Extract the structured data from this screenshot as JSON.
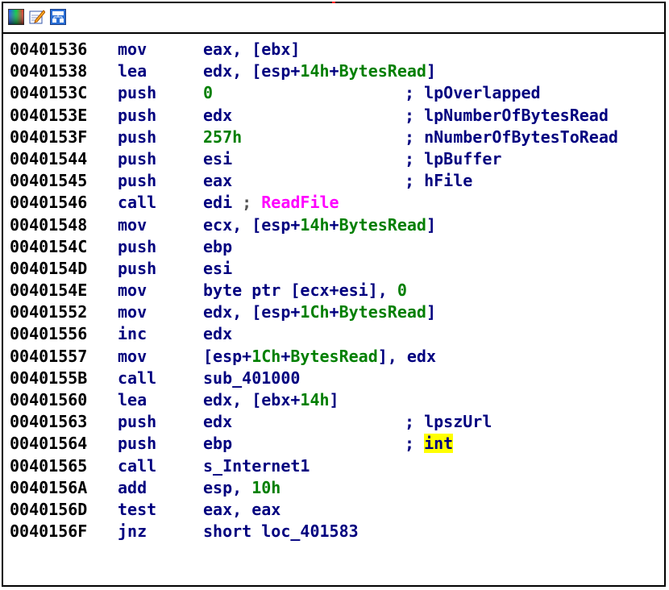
{
  "window": {
    "toolbar": [
      {
        "name": "graph-overview-icon"
      },
      {
        "name": "edit-icon"
      },
      {
        "name": "flowchart-icon"
      }
    ],
    "accent_colors": {
      "address": "#000000",
      "code": "#00007f",
      "number": "#007f00",
      "api_name": "#ff00ff",
      "highlight": "#ffff00",
      "marker": "#ff0000"
    }
  },
  "lines": [
    {
      "addr": "00401536",
      "mnemonic": "mov",
      "op": [
        [
          "plain",
          "eax, [ebx]"
        ]
      ],
      "comment": []
    },
    {
      "addr": "00401538",
      "mnemonic": "lea",
      "op": [
        [
          "plain",
          "edx, [esp+"
        ],
        [
          "num",
          "14h"
        ],
        [
          "plain",
          "+"
        ],
        [
          "var",
          "BytesRead"
        ],
        [
          "plain",
          "]"
        ]
      ],
      "comment": []
    },
    {
      "addr": "0040153C",
      "mnemonic": "push",
      "op": [
        [
          "num",
          "0"
        ]
      ],
      "comment": [
        [
          "plain",
          "; lpOverlapped"
        ]
      ]
    },
    {
      "addr": "0040153E",
      "mnemonic": "push",
      "op": [
        [
          "plain",
          "edx"
        ]
      ],
      "comment": [
        [
          "plain",
          "; lpNumberOfBytesRead"
        ]
      ]
    },
    {
      "addr": "0040153F",
      "mnemonic": "push",
      "op": [
        [
          "num",
          "257h"
        ]
      ],
      "comment": [
        [
          "plain",
          "; nNumberOfBytesToRead"
        ]
      ]
    },
    {
      "addr": "00401544",
      "mnemonic": "push",
      "op": [
        [
          "plain",
          "esi"
        ]
      ],
      "comment": [
        [
          "plain",
          "; lpBuffer"
        ]
      ]
    },
    {
      "addr": "00401545",
      "mnemonic": "push",
      "op": [
        [
          "plain",
          "eax"
        ]
      ],
      "comment": [
        [
          "plain",
          "; hFile"
        ]
      ]
    },
    {
      "addr": "00401546",
      "mnemonic": "call",
      "op": [
        [
          "plain",
          "edi "
        ],
        [
          "sep",
          "; "
        ],
        [
          "api",
          "ReadFile"
        ]
      ],
      "comment": []
    },
    {
      "addr": "00401548",
      "mnemonic": "mov",
      "op": [
        [
          "plain",
          "ecx, [esp+"
        ],
        [
          "num",
          "14h"
        ],
        [
          "plain",
          "+"
        ],
        [
          "var",
          "BytesRead"
        ],
        [
          "plain",
          "]"
        ]
      ],
      "comment": []
    },
    {
      "addr": "0040154C",
      "mnemonic": "push",
      "op": [
        [
          "plain",
          "ebp"
        ]
      ],
      "comment": []
    },
    {
      "addr": "0040154D",
      "mnemonic": "push",
      "op": [
        [
          "plain",
          "esi"
        ]
      ],
      "comment": []
    },
    {
      "addr": "0040154E",
      "mnemonic": "mov",
      "op": [
        [
          "plain",
          "byte ptr [ecx+esi], "
        ],
        [
          "num",
          "0"
        ]
      ],
      "comment": []
    },
    {
      "addr": "00401552",
      "mnemonic": "mov",
      "op": [
        [
          "plain",
          "edx, [esp+"
        ],
        [
          "num",
          "1Ch"
        ],
        [
          "plain",
          "+"
        ],
        [
          "var",
          "BytesRead"
        ],
        [
          "plain",
          "]"
        ]
      ],
      "comment": []
    },
    {
      "addr": "00401556",
      "mnemonic": "inc",
      "op": [
        [
          "plain",
          "edx"
        ]
      ],
      "comment": []
    },
    {
      "addr": "00401557",
      "mnemonic": "mov",
      "op": [
        [
          "plain",
          "[esp+"
        ],
        [
          "num",
          "1Ch"
        ],
        [
          "plain",
          "+"
        ],
        [
          "var",
          "BytesRead"
        ],
        [
          "plain",
          "], edx"
        ]
      ],
      "comment": []
    },
    {
      "addr": "0040155B",
      "mnemonic": "call",
      "op": [
        [
          "plain",
          "sub_401000"
        ]
      ],
      "comment": []
    },
    {
      "addr": "00401560",
      "mnemonic": "lea",
      "op": [
        [
          "plain",
          "edx, [ebx+"
        ],
        [
          "num",
          "14h"
        ],
        [
          "plain",
          "]"
        ]
      ],
      "comment": []
    },
    {
      "addr": "00401563",
      "mnemonic": "push",
      "op": [
        [
          "plain",
          "edx"
        ]
      ],
      "comment": [
        [
          "plain",
          "; lpszUrl"
        ]
      ]
    },
    {
      "addr": "00401564",
      "mnemonic": "push",
      "op": [
        [
          "plain",
          "ebp"
        ]
      ],
      "comment": [
        [
          "plain",
          "; "
        ],
        [
          "hl",
          "int"
        ]
      ]
    },
    {
      "addr": "00401565",
      "mnemonic": "call",
      "op": [
        [
          "plain",
          "s_Internet1"
        ]
      ],
      "comment": []
    },
    {
      "addr": "0040156A",
      "mnemonic": "add",
      "op": [
        [
          "plain",
          "esp, "
        ],
        [
          "num",
          "10h"
        ]
      ],
      "comment": []
    },
    {
      "addr": "0040156D",
      "mnemonic": "test",
      "op": [
        [
          "plain",
          "eax, eax"
        ]
      ],
      "comment": []
    },
    {
      "addr": "0040156F",
      "mnemonic": "jnz",
      "op": [
        [
          "plain",
          "short loc_401583"
        ]
      ],
      "comment": []
    }
  ]
}
